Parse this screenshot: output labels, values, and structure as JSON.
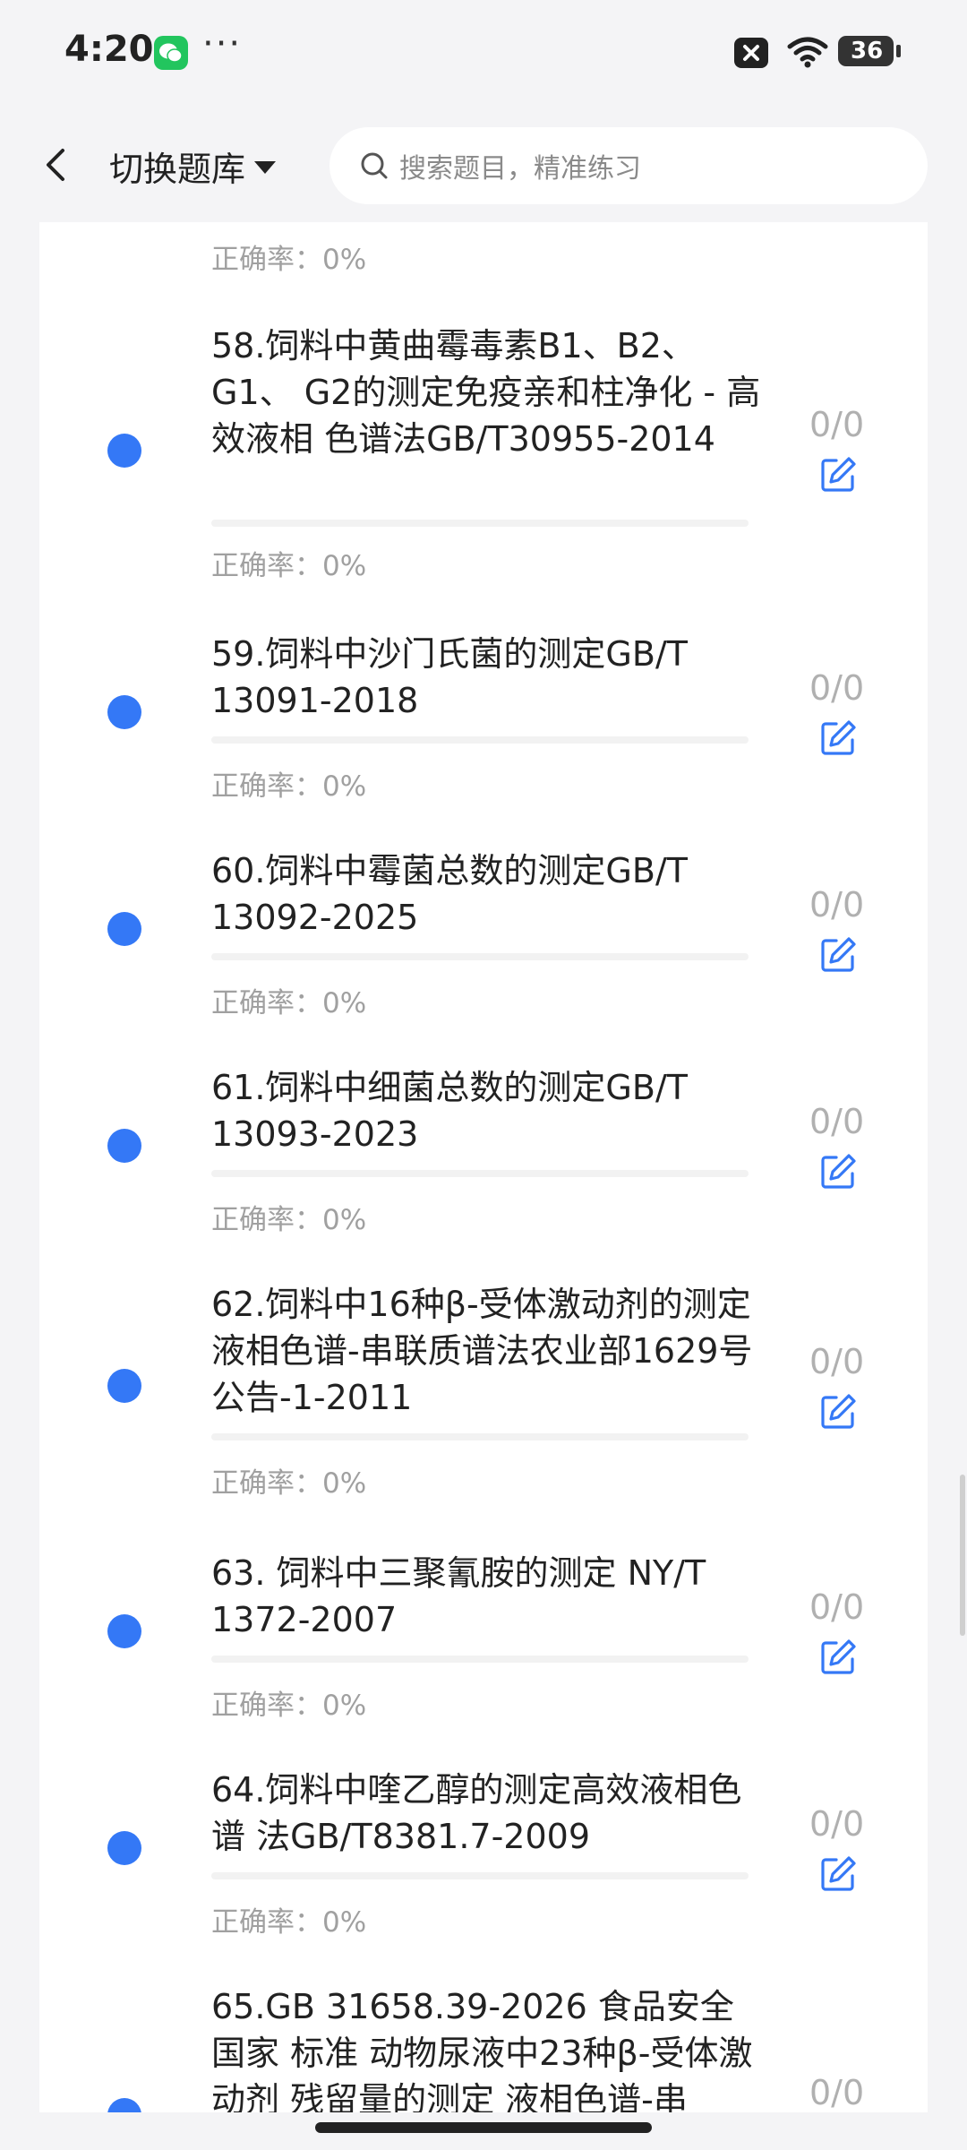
{
  "status": {
    "time": "4:20",
    "more": "···",
    "battery": "36"
  },
  "header": {
    "switch_label": "切换题库",
    "search_placeholder": "搜索题目，精准练习"
  },
  "accuracy_label": "正确率：0%",
  "items": [
    {
      "title": "58.饲料中黄曲霉毒素B1、B2、G1、 G2的测定免疫亲和柱净化 - 高效液相 色谱法GB/T30955-2014",
      "count": "0/0",
      "accuracy": "正确率：0%",
      "progress": 0
    },
    {
      "title": "59.饲料中沙门氏菌的测定GB/T 13091-2018",
      "count": "0/0",
      "accuracy": "正确率：0%",
      "progress": 0
    },
    {
      "title": "60.饲料中霉菌总数的测定GB/T 13092-2025",
      "count": "0/0",
      "accuracy": "正确率：0%",
      "progress": 0
    },
    {
      "title": "61.饲料中细菌总数的测定GB/T 13093-2023",
      "count": "0/0",
      "accuracy": "正确率：0%",
      "progress": 0
    },
    {
      "title": "62.饲料中16种β-受体激动剂的测定 液相色谱-串联质谱法农业部1629号公告-1-2011",
      "count": "0/0",
      "accuracy": "正确率：0%",
      "progress": 0
    },
    {
      "title": "63. 饲料中三聚氰胺的测定 NY/T 1372-2007",
      "count": "0/0",
      "accuracy": "正确率：0%",
      "progress": 0
    },
    {
      "title": "64.饲料中喹乙醇的测定高效液相色谱 法GB/T8381.7-2009",
      "count": "0/0",
      "accuracy": "正确率：0%",
      "progress": 0
    },
    {
      "title": "65.GB 31658.39-2026 食品安全国家 标准 动物尿液中23种β-受体激动剂 残留量的测定 液相色谱-串",
      "count": "0/0",
      "accuracy": "",
      "progress": 0
    }
  ],
  "colors": {
    "accent": "#3478f6",
    "muted": "#a0a0a0"
  }
}
